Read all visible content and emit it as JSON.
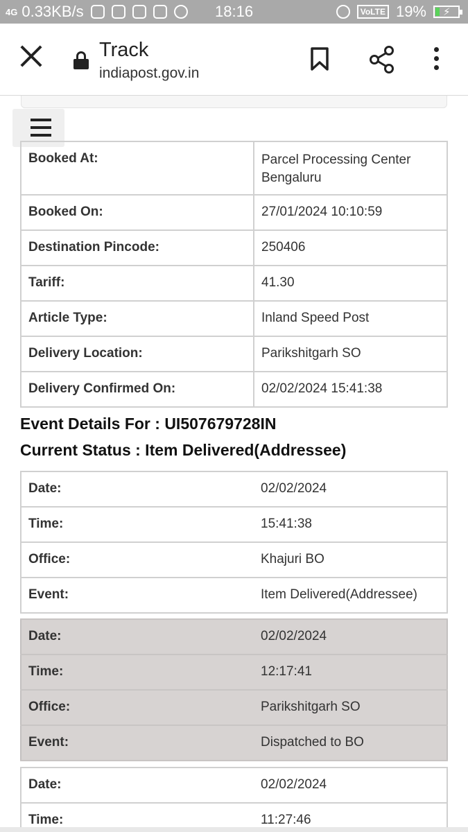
{
  "status_bar": {
    "network": "4G",
    "speed": "0.33KB/s",
    "time": "18:16",
    "volte": "VoLTE",
    "battery": "19%",
    "battery_level": 0.19
  },
  "browser": {
    "title": "Track",
    "url": "indiapost.gov.in"
  },
  "booking": [
    {
      "label": "Booked At:",
      "value": "Parcel Processing Center Bengaluru"
    },
    {
      "label": "Booked On:",
      "value": "27/01/2024 10:10:59"
    },
    {
      "label": "Destination Pincode:",
      "value": "250406"
    },
    {
      "label": "Tariff:",
      "value": "41.30"
    },
    {
      "label": "Article Type:",
      "value": "Inland Speed Post"
    },
    {
      "label": "Delivery Location:",
      "value": "Parikshitgarh SO"
    },
    {
      "label": "Delivery Confirmed On:",
      "value": "02/02/2024 15:41:38"
    }
  ],
  "event_details_heading": "Event Details For : UI507679728IN",
  "current_status_heading": "Current Status : Item Delivered(Addressee)",
  "events": [
    {
      "date_label": "Date:",
      "date": "02/02/2024",
      "time_label": "Time:",
      "time": "15:41:38",
      "office_label": "Office:",
      "office": "Khajuri BO",
      "event_label": "Event:",
      "event": "Item Delivered(Addressee)"
    },
    {
      "date_label": "Date:",
      "date": "02/02/2024",
      "time_label": "Time:",
      "time": "12:17:41",
      "office_label": "Office:",
      "office": "Parikshitgarh SO",
      "event_label": "Event:",
      "event": "Dispatched to BO"
    },
    {
      "date_label": "Date:",
      "date": "02/02/2024",
      "time_label": "Time:",
      "time": "11:27:46"
    }
  ]
}
